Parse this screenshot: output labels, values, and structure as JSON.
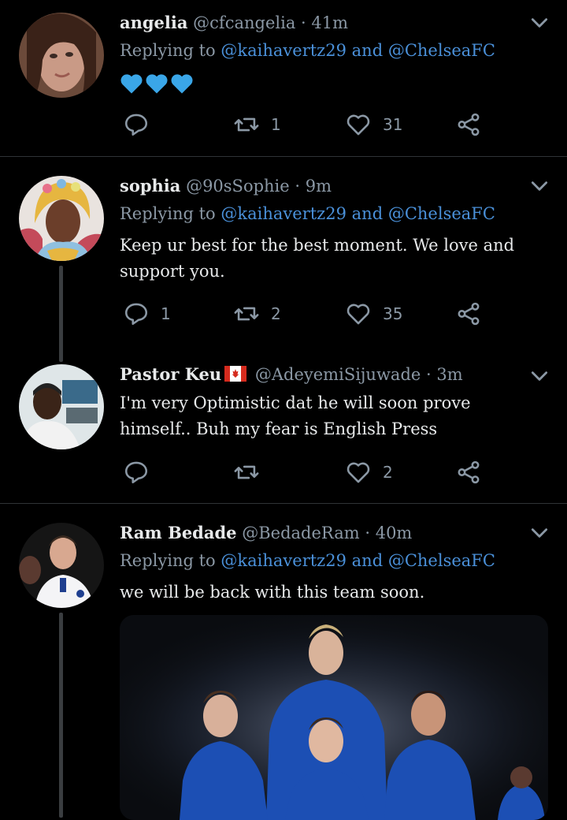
{
  "tweets": [
    {
      "name": "angelia",
      "handle": "@cfcangelia",
      "separator": "·",
      "time": "41m",
      "reply_prefix": "Replying to",
      "reply_to_1": "@kaihavertz29",
      "reply_and": "and",
      "reply_to_2": "@ChelseaFC",
      "content": "💙💙💙",
      "reply_count": "",
      "retweet_count": "1",
      "like_count": "31"
    },
    {
      "name": "sophia",
      "handle": "@90sSophie",
      "separator": "·",
      "time": "9m",
      "reply_prefix": "Replying to",
      "reply_to_1": "@kaihavertz29",
      "reply_and": "and",
      "reply_to_2": "@ChelseaFC",
      "content": "Keep ur best for the best moment. We love and support you.",
      "reply_count": "1",
      "retweet_count": "2",
      "like_count": "35"
    },
    {
      "name": "Pastor Keu",
      "flag_icon": "canada-flag-icon",
      "handle": "@AdeyemiSijuwade",
      "separator": "·",
      "time": "3m",
      "content": "I'm very Optimistic dat he will soon prove himself.. Buh my fear is English Press",
      "reply_count": "",
      "retweet_count": "",
      "like_count": "2"
    },
    {
      "name": "Ram Bedade",
      "handle": "@BedadeRam",
      "separator": "·",
      "time": "40m",
      "reply_prefix": "Replying to",
      "reply_to_1": "@kaihavertz29",
      "reply_and": "and",
      "reply_to_2": "@ChelseaFC",
      "content": "we will be back with this team soon."
    }
  ],
  "icons": {
    "reply": "reply-icon",
    "retweet": "retweet-icon",
    "like": "heart-icon",
    "share": "share-icon",
    "menu": "chevron-down-icon"
  },
  "colors": {
    "background": "#000000",
    "text": "#e7e9ea",
    "muted": "#8b98a5",
    "link": "#4a90d9",
    "heart_emoji": "#3aa6e8",
    "divider": "#2f3336"
  }
}
